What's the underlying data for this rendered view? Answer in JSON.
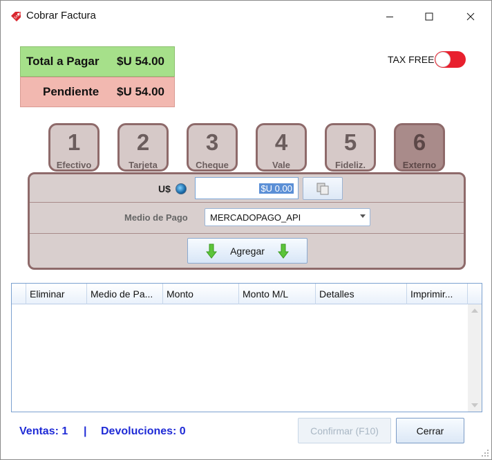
{
  "window": {
    "title": "Cobrar Factura",
    "icon": "sale-tag-icon"
  },
  "summary": {
    "total_label": "Total a Pagar",
    "total_value": "$U 54.00",
    "pending_label": "Pendiente",
    "pending_value": "$U 54.00",
    "total_bg": "#a6e08a",
    "pending_bg": "#f2b8b0"
  },
  "tax_free": {
    "label": "TAX FREE",
    "on": false,
    "toggle_color": "#e8202e"
  },
  "tabs": [
    {
      "number": "1",
      "label": "Efectivo",
      "active": false
    },
    {
      "number": "2",
      "label": "Tarjeta",
      "active": false
    },
    {
      "number": "3",
      "label": "Cheque",
      "active": false
    },
    {
      "number": "4",
      "label": "Vale",
      "active": false
    },
    {
      "number": "5",
      "label": "Fideliz.",
      "active": false
    },
    {
      "number": "6",
      "label": "Externo",
      "active": true
    }
  ],
  "payment": {
    "currency_label": "U$",
    "amount_value": "$U 0.00",
    "payment_method_label": "Medio de Pago",
    "payment_method_value": "MERCADOPAGO_API",
    "add_label": "Agregar"
  },
  "grid": {
    "columns": [
      "Eliminar",
      "Medio de Pa...",
      "Monto",
      "Monto M/L",
      "Detalles",
      "Imprimir..."
    ],
    "rows": []
  },
  "footer": {
    "sales_text": "Ventas: 1",
    "separator": "|",
    "returns_text": "Devoluciones: 0",
    "confirm_label": "Confirmar (F10)",
    "close_label": "Cerrar",
    "status_color": "#1f2bd6"
  }
}
